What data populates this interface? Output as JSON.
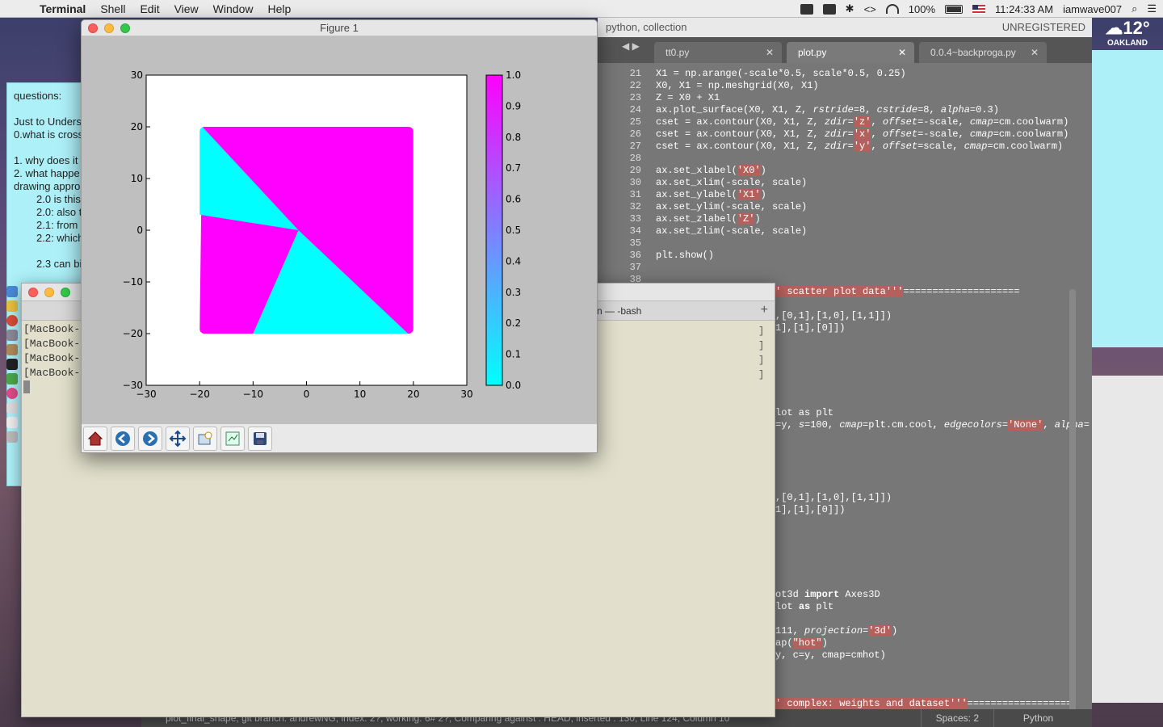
{
  "menubar": {
    "app": "Terminal",
    "items": [
      "Shell",
      "Edit",
      "View",
      "Window",
      "Help"
    ],
    "battery": "100%",
    "clock": "11:24:33 AM",
    "user": "iamwave007"
  },
  "weather": {
    "temp": "12°",
    "city": "OAKLAND"
  },
  "notes": {
    "lines": [
      {
        "text": "questions:",
        "indent": false
      },
      {
        "text": "",
        "indent": false
      },
      {
        "text": "Just to Unders",
        "indent": false
      },
      {
        "text": "0.what is cross",
        "indent": false
      },
      {
        "text": "",
        "indent": false
      },
      {
        "text": "1. why does it",
        "indent": false
      },
      {
        "text": "2. what happe",
        "indent": false
      },
      {
        "text": "drawing appro",
        "indent": false
      },
      {
        "text": "2.0 is this",
        "indent": true
      },
      {
        "text": "2.0: also t",
        "indent": true
      },
      {
        "text": "2.1: from",
        "indent": true
      },
      {
        "text": "2.2: which",
        "indent": true
      },
      {
        "text": "",
        "indent": false
      },
      {
        "text": "2.3 can bi",
        "indent": true
      }
    ]
  },
  "editor": {
    "title": "python, collection",
    "unregistered": "UNREGISTERED",
    "tabs": [
      {
        "label": "tt0.py",
        "active": false
      },
      {
        "label": "plot.py",
        "active": true
      },
      {
        "label": "0.0.4~backproga.py",
        "active": false
      }
    ],
    "line_numbers": [
      "21",
      "22",
      "23",
      "24",
      "25",
      "26",
      "27",
      "28",
      "29",
      "30",
      "31",
      "32",
      "33",
      "34",
      "35",
      "36",
      "37",
      "38"
    ],
    "code": {
      "l21": "X1 = np.arange(-scale*0.5, scale*0.5, 0.25)",
      "l22": "X0, X1 = np.meshgrid(X0, X1)",
      "l23": "Z = X0 + X1",
      "l24a": "ax.plot_surface(X0, X1, Z, ",
      "l24b": "rstride",
      "l24c": "=8, ",
      "l24d": "cstride",
      "l24e": "=8, ",
      "l24f": "alpha",
      "l24g": "=0.3)",
      "l25a": "cset = ax.contour(X0, X1, Z, ",
      "l25z": "zdir",
      "l25s": "'z'",
      "l25o": "offset",
      "l25ov": "=-scale, ",
      "l25c": "cmap",
      "l25cv": "=cm.coolwarm)",
      "l26s": "'x'",
      "l27s": "'y'",
      "l27ov": "=scale, ",
      "l29a": "ax.set_xlabel(",
      "l29s": "'X0'",
      "l30": "ax.set_xlim(-scale, scale)",
      "l31a": "ax.set_ylabel(",
      "l31s": "'X1'",
      "l32": "ax.set_ylim(-scale, scale)",
      "l33a": "ax.set_zlabel(",
      "l33s": "'Z'",
      "l34": "ax.set_zlim(-scale, scale)",
      "l36": "plt.show()",
      "scatter_hdr": "' scatter plot data'''",
      "scatter_eq": "====================",
      "arr1": ",[0,1],[1,0],[1,1]])",
      "arr2": "1],[1],[0]])",
      "plt_imp": "lot as plt",
      "scatter_call_a": "=y, ",
      "scatter_s": "s",
      "scatter_sv": "=100, ",
      "scatter_cmap": "cmap",
      "scatter_cmapv": "=plt.cm.cool, ",
      "scatter_edge": "edgecolors",
      "scatter_none": "'None'",
      "scatter_alpha": "alpha=",
      "arr3": ",[0,1],[1,0],[1,1]])",
      "arr4": "1],[1],[0]])",
      "ax3d_a": "ot3d ",
      "ax3d_kw": "import",
      "ax3d_b": " Axes3D",
      "plt2_a": "lot ",
      "plt2_kw": "as",
      "plt2_b": " plt",
      "proj_a": "111, ",
      "proj_k": "projection",
      "proj_s": "'3d'",
      "proj_e": ")",
      "hot_a": "ap(",
      "hot_s": "\"hot\"",
      "hot_e": ")",
      "cmhot": "y, c=y, cmap=cmhot)",
      "complex_hdr": "' complex: weights and dataset'''",
      "complex_eq": "=================="
    },
    "status": "plot_final_shape, git branch: andrewNG, index: 2?, working: 6# 2?, Comparing against : HEAD, inserted : 130, Line 124, Column 10",
    "spaces": "Spaces: 2",
    "language": "Python"
  },
  "terminal": {
    "tab_title": "n — -bash",
    "lines": [
      "[MacBook-",
      "[MacBook-",
      "[MacBook-",
      "[MacBook-"
    ]
  },
  "figure": {
    "title": "Figure 1",
    "colors": {
      "magenta": "#ff00ff",
      "cyan": "#00ffff"
    },
    "colorbar": {
      "ticks": [
        "1.0",
        "0.9",
        "0.8",
        "0.7",
        "0.6",
        "0.5",
        "0.4",
        "0.3",
        "0.2",
        "0.1",
        "0.0"
      ],
      "cmap": "cool"
    },
    "toolbar": [
      "home-icon",
      "back-icon",
      "forward-icon",
      "pan-icon",
      "zoom-icon",
      "subplots-icon",
      "save-icon"
    ]
  },
  "chart_data": {
    "type": "scatter",
    "title": "",
    "xlabel": "",
    "ylabel": "",
    "xlim": [
      -30,
      30
    ],
    "ylim": [
      -30,
      30
    ],
    "xticks": [
      "−30",
      "−20",
      "−10",
      "0",
      "10",
      "20",
      "30"
    ],
    "yticks": [
      "30",
      "20",
      "10",
      "0",
      "−10",
      "−20",
      "−30"
    ],
    "grid": false,
    "regions": [
      {
        "name": "magenta",
        "value": 1.0,
        "polygon": [
          [
            -19.5,
            20
          ],
          [
            20,
            20
          ],
          [
            20,
            -20
          ],
          [
            -20,
            -20
          ]
        ]
      },
      {
        "name": "cyan",
        "value": 0.0,
        "polygon": [
          [
            -20,
            20
          ],
          [
            -19.5,
            20
          ],
          [
            -1.5,
            0
          ],
          [
            -20,
            3
          ]
        ]
      },
      {
        "name": "cyan",
        "value": 0.0,
        "polygon": [
          [
            -1.5,
            0
          ],
          [
            19,
            -20
          ],
          [
            -10,
            -20
          ]
        ]
      }
    ]
  }
}
